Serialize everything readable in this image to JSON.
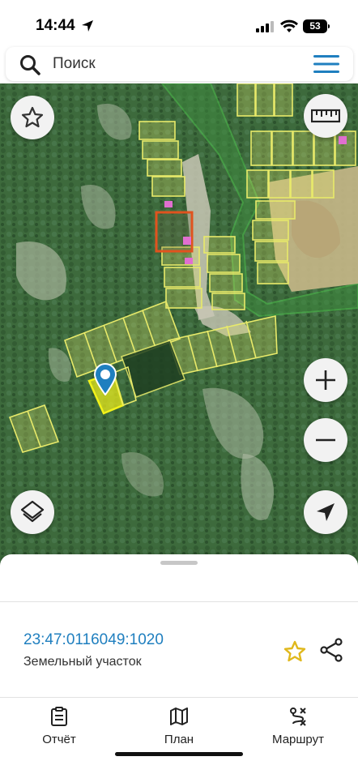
{
  "status_bar": {
    "time": "14:44",
    "battery": "53"
  },
  "search": {
    "placeholder": "Поиск"
  },
  "map": {
    "selected_parcel_color": "#f2f21a",
    "parcel_outline_color": "#e8ea6a",
    "highlight_parcel_color": "#e0531e",
    "forest_color": "#2f5a33"
  },
  "parcel": {
    "cadastral_number": "23:47:0116049:1020",
    "type": "Земельный участок"
  },
  "tabs": [
    {
      "label": "Отчёт",
      "icon": "report-icon"
    },
    {
      "label": "План",
      "icon": "map-plan-icon"
    },
    {
      "label": "Маршрут",
      "icon": "route-icon"
    }
  ],
  "colors": {
    "accent": "#1f7fbf",
    "star": "#e0b81c"
  }
}
